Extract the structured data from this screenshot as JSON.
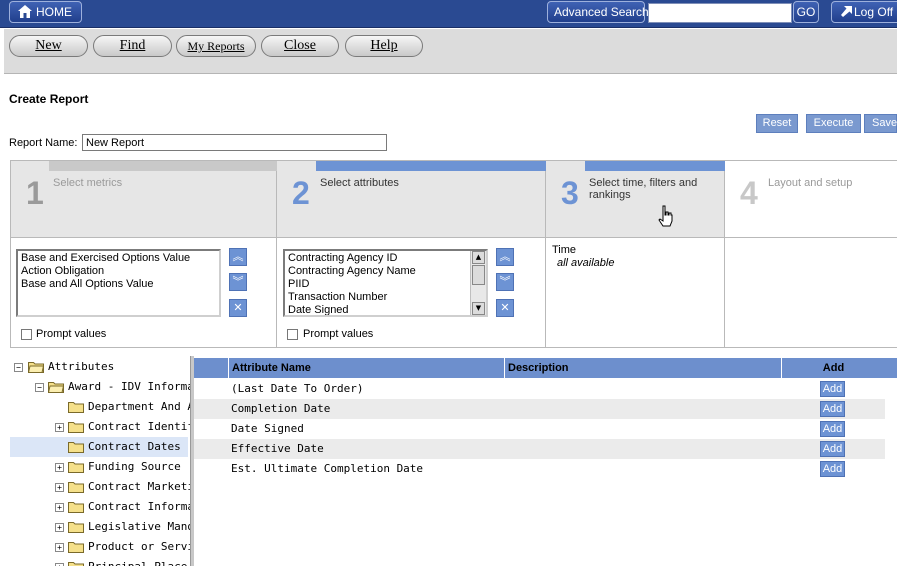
{
  "topnav": {
    "home_label": "HOME",
    "advanced_search_label": "Advanced Search",
    "search_value": "",
    "go_label": "GO",
    "logoff_label": "Log Off"
  },
  "toolbar": {
    "new_label": "New",
    "find_label": "Find",
    "my_reports_label": "My Reports",
    "close_label": "Close",
    "help_label": "Help"
  },
  "page": {
    "title": "Create Report",
    "report_name_label": "Report Name:",
    "report_name_value": "New Report",
    "reset_label": "Reset",
    "execute_label": "Execute",
    "save_label": "Save"
  },
  "steps": [
    {
      "number": "1",
      "label": "Select metrics"
    },
    {
      "number": "2",
      "label": "Select attributes"
    },
    {
      "number": "3",
      "label": "Select time, filters and rankings"
    },
    {
      "number": "4",
      "label": "Layout and setup"
    }
  ],
  "metrics": {
    "items": [
      "Base and Exercised Options Value",
      "Action Obligation",
      "Base and All Options Value"
    ],
    "prompt_label": "Prompt values"
  },
  "attributes": {
    "items": [
      "Contracting Agency ID",
      "Contracting Agency Name",
      "PIID",
      "Transaction Number",
      "Date Signed"
    ],
    "prompt_label": "Prompt values"
  },
  "time": {
    "heading": "Time",
    "value": "all available"
  },
  "tree": {
    "root": "Attributes",
    "group": "Award - IDV Informat",
    "children": [
      {
        "label": "Department And A",
        "expandable": false,
        "selected": false
      },
      {
        "label": "Contract Identifica",
        "expandable": true,
        "selected": false
      },
      {
        "label": "Contract Dates",
        "expandable": false,
        "selected": true
      },
      {
        "label": "Funding Source",
        "expandable": true,
        "selected": false
      },
      {
        "label": "Contract Marketin",
        "expandable": true,
        "selected": false
      },
      {
        "label": "Contract Informat",
        "expandable": true,
        "selected": false
      },
      {
        "label": "Legislative Manda",
        "expandable": true,
        "selected": false
      },
      {
        "label": "Product or Service",
        "expandable": true,
        "selected": false
      },
      {
        "label": "Principal Place of",
        "expandable": true,
        "selected": false
      }
    ]
  },
  "grid": {
    "columns": {
      "name": "Attribute Name",
      "description": "Description",
      "add": "Add"
    },
    "rows": [
      {
        "name": "(Last Date To Order)",
        "description": "",
        "add": "Add"
      },
      {
        "name": "Completion Date",
        "description": "",
        "add": "Add"
      },
      {
        "name": "Date Signed",
        "description": "",
        "add": "Add"
      },
      {
        "name": "Effective Date",
        "description": "",
        "add": "Add"
      },
      {
        "name": "Est. Ultimate Completion Date",
        "description": "",
        "add": "Add"
      }
    ]
  },
  "colors": {
    "nav": "#2a4a92",
    "accent": "#6d8fcd",
    "button": "#7a99cf",
    "selected_row": "#dbe6f7"
  }
}
